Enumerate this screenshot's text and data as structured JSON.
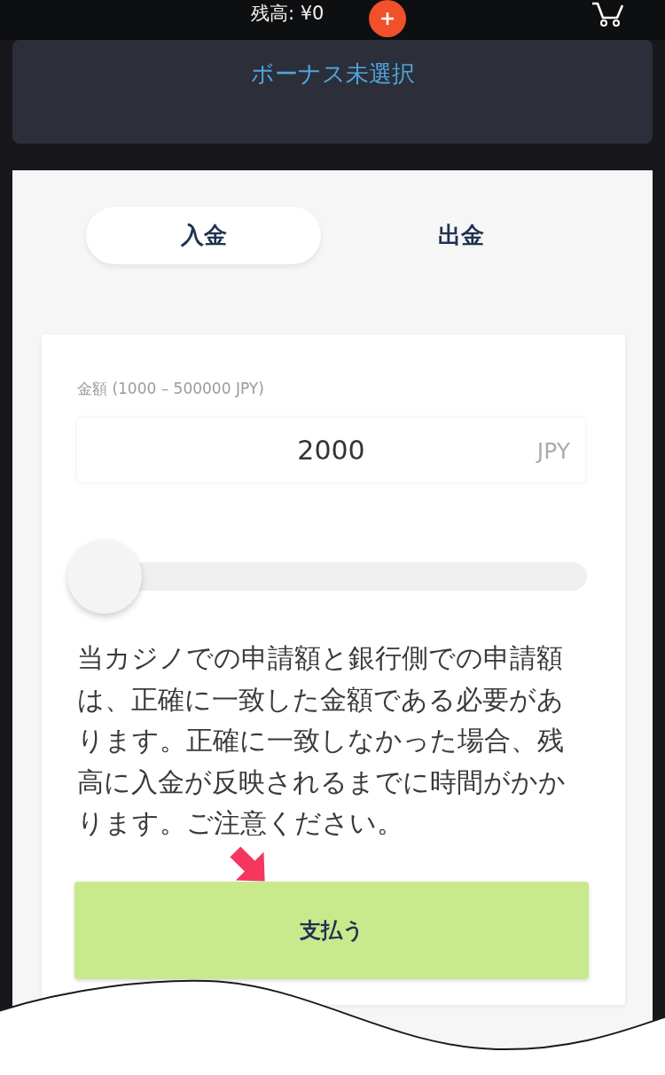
{
  "header": {
    "balance": "残高: ¥0"
  },
  "bonus": {
    "label": "ボーナス未選択"
  },
  "tabs": [
    {
      "label": "入金",
      "selected": true
    },
    {
      "label": "出金",
      "selected": false
    }
  ],
  "amount": {
    "label": "金額 (1000 – 500000 JPY)",
    "value": "2000",
    "currency": "JPY"
  },
  "slider": {
    "level": 0
  },
  "notice": "当カジノでの申請額と銀行側での申請額は、正確に一致した金額である必要があります。正確に一致しなかった場合、残高に入金が反映されるまでに時間がかかります。ご注意ください。",
  "pay_button": {
    "label": "支払う"
  }
}
